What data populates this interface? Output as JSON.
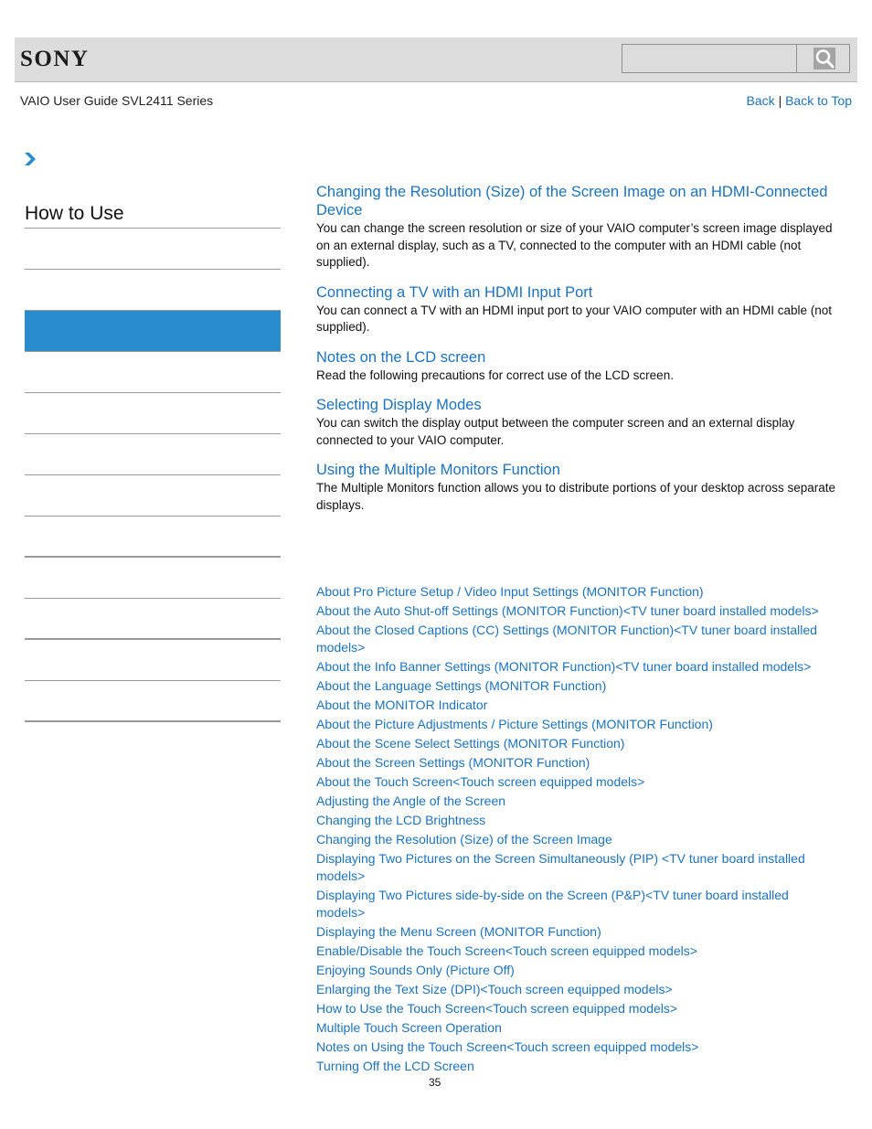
{
  "header": {
    "logo": "SONY",
    "search": {
      "value": "",
      "placeholder": ""
    },
    "guide_title": "VAIO User Guide SVL2411 Series",
    "nav": {
      "back": "Back",
      "separator": "|",
      "back_to_top": "Back to Top"
    }
  },
  "sidebar": {
    "title": "How to Use",
    "items": [
      {
        "label": "",
        "active": false
      },
      {
        "label": "",
        "active": false
      },
      {
        "label": "",
        "active": true
      },
      {
        "label": "",
        "active": false
      },
      {
        "label": "",
        "active": false
      },
      {
        "label": "",
        "active": false
      },
      {
        "label": "",
        "active": false
      },
      {
        "label": "",
        "active": false
      },
      {
        "label": "",
        "active": false
      },
      {
        "label": "",
        "active": false
      },
      {
        "label": "",
        "active": false
      },
      {
        "label": "",
        "active": false
      }
    ],
    "active_color": "#298ccc"
  },
  "main": {
    "topics": [
      {
        "title": "Changing the Resolution (Size) of the Screen Image on an HDMI-Connected Device",
        "description": "You can change the screen resolution or size of your VAIO computer’s screen image displayed on an external display, such as a TV, connected to the computer with an HDMI cable (not supplied)."
      },
      {
        "title": "Connecting a TV with an HDMI Input Port",
        "description": "You can connect a TV with an HDMI input port to your VAIO computer with an HDMI cable (not supplied)."
      },
      {
        "title": "Notes on the LCD screen",
        "description": "Read the following precautions for correct use of the LCD screen."
      },
      {
        "title": "Selecting Display Modes",
        "description": "You can switch the display output between the computer screen and an external display connected to your VAIO computer."
      },
      {
        "title": "Using the Multiple Monitors Function",
        "description": "The Multiple Monitors function allows you to distribute portions of your desktop across separate displays."
      }
    ],
    "related_links": [
      "About Pro Picture Setup / Video Input Settings (MONITOR Function)",
      "About the Auto Shut-off Settings (MONITOR Function)<TV tuner board installed models>",
      "About the Closed Captions (CC) Settings (MONITOR Function)<TV tuner board installed models>",
      "About the Info Banner Settings (MONITOR Function)<TV tuner board installed models>",
      "About the Language Settings (MONITOR Function)",
      "About the MONITOR Indicator",
      "About the Picture Adjustments / Picture Settings (MONITOR Function)",
      "About the Scene Select Settings (MONITOR Function)",
      "About the Screen Settings (MONITOR Function)",
      "About the Touch Screen<Touch screen equipped models>",
      "Adjusting the Angle of the Screen",
      "Changing the LCD Brightness",
      "Changing the Resolution (Size) of the Screen Image",
      "Displaying Two Pictures on the Screen Simultaneously (PIP) <TV tuner board installed models>",
      "Displaying Two Pictures side-by-side on the Screen (P&P)<TV tuner board installed models>",
      "Displaying the Menu Screen (MONITOR Function)",
      "Enable/Disable the Touch Screen<Touch screen equipped models>",
      "Enjoying Sounds Only (Picture Off)",
      "Enlarging the Text Size (DPI)<Touch screen equipped models>",
      "How to Use the Touch Screen<Touch screen equipped models>",
      "Multiple Touch Screen Operation",
      "Notes on Using the Touch Screen<Touch screen equipped models>",
      "Turning Off the LCD Screen"
    ]
  },
  "footer": {
    "page_number": "35"
  },
  "colors": {
    "link": "#1a73c1",
    "header_bg": "#dcdcdc",
    "accent": "#298ccc"
  }
}
